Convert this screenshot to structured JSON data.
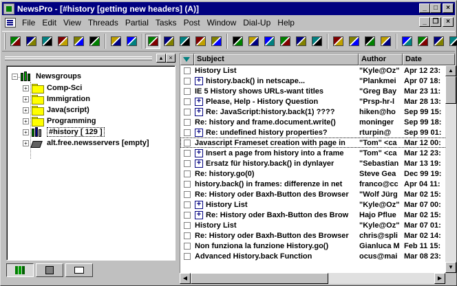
{
  "window": {
    "title": "NewsPro - [#history [getting new headers] (A)]"
  },
  "menu": [
    "File",
    "Edit",
    "View",
    "Threads",
    "Partial",
    "Tasks",
    "Post",
    "Window",
    "Dial-Up",
    "Help"
  ],
  "toolbar": {
    "icons": [
      "connect-icon",
      "disconnect-icon",
      "get-headers-icon",
      "open-book-icon",
      "catalog-icon",
      "search-book-icon",
      "new-folder-icon",
      "delete-folder-icon",
      "threads-icon",
      "tree-icon",
      "tasks-icon",
      "news-icon",
      "filter-icon",
      "binoculars-icon",
      "find-icon",
      "filter-view-icon",
      "browse-icon",
      "library-icon",
      "log-icon",
      "mail-icon",
      "save-icon",
      "outbox-icon",
      "post-icon",
      "network-icon",
      "layout-icon",
      "window-icon",
      "columns-icon"
    ],
    "pressed_index": 8
  },
  "tree": {
    "root": "Newsgroups",
    "items": [
      {
        "label": "Comp-Sci",
        "type": "folder"
      },
      {
        "label": "Immigration",
        "type": "folder"
      },
      {
        "label": "Java(script)",
        "type": "folder"
      },
      {
        "label": "Programming",
        "type": "folder"
      },
      {
        "label": "#history  [ 129 ]",
        "type": "group-open"
      },
      {
        "label": "alt.free.newsservers  [empty]",
        "type": "server"
      }
    ]
  },
  "list": {
    "columns": [
      "Subject",
      "Author",
      "Date"
    ],
    "rows": [
      {
        "subject": "History List",
        "author": "\"Kyle@Oz\"",
        "date": "Apr 12 23:",
        "thread": false
      },
      {
        "subject": "history.back() in netscape...",
        "author": "\"Plankmei",
        "date": "Apr 07 18:",
        "thread": true
      },
      {
        "subject": "IE 5 History shows URLs-want titles",
        "author": "\"Greg Bay",
        "date": "Mar 23 11:",
        "thread": false
      },
      {
        "subject": "Please, Help - History Question",
        "author": "\"Prsp-hr-l",
        "date": "Mar 28 13:",
        "thread": true
      },
      {
        "subject": "Re: JavaScript:history.back(1) ????",
        "author": "hiken@ho",
        "date": "Sep 99 15:",
        "thread": true
      },
      {
        "subject": "Re: history and frame.document.write()",
        "author": "moninger",
        "date": "Sep 99 18:",
        "thread": false
      },
      {
        "subject": "Re: undefined history properties?",
        "author": "rturpin@",
        "date": "Sep 99 01:",
        "thread": true
      },
      {
        "subject": "Javascript Frameset creation with page in",
        "author": "\"Tom\" <ca",
        "date": "Mar 12 00:",
        "thread": false,
        "focused": true
      },
      {
        "subject": "Insert a page from history into a frame",
        "author": "\"Tom\" <ca",
        "date": "Mar 12 23:",
        "thread": true
      },
      {
        "subject": "Ersatz für history.back() in dynlayer",
        "author": "\"Sebastian",
        "date": "Mar 13 19:",
        "thread": true
      },
      {
        "subject": "Re: history.go(0)",
        "author": "Steve Gea",
        "date": "Dec 99 19:",
        "thread": false
      },
      {
        "subject": "history.back() in frames: differenze in net",
        "author": "franco@cc",
        "date": "Apr 04 11:",
        "thread": false
      },
      {
        "subject": "Re: History oder Baxh-Button des Browser",
        "author": "\"Wolf Jürg",
        "date": "Mar 02 15:",
        "thread": false
      },
      {
        "subject": "History List",
        "author": "\"Kyle@Oz\"",
        "date": "Mar 07 00:",
        "thread": true
      },
      {
        "subject": "Re: History oder Baxh-Button des Brow",
        "author": "Hajo Pflue",
        "date": "Mar 02 15:",
        "thread": true
      },
      {
        "subject": "History List",
        "author": "\"Kyle@Oz\"",
        "date": "Mar 07 01:",
        "thread": false
      },
      {
        "subject": "Re: History oder Baxh-Button des Browser",
        "author": "chris@spli",
        "date": "Mar 02 14:",
        "thread": false
      },
      {
        "subject": "Non funziona la funzione History.go()",
        "author": "Gianluca M",
        "date": "Feb 11 15:",
        "thread": false
      },
      {
        "subject": "Advanced History.back Function",
        "author": "ocus@mai",
        "date": "Mar 08 23:",
        "thread": false
      }
    ]
  }
}
